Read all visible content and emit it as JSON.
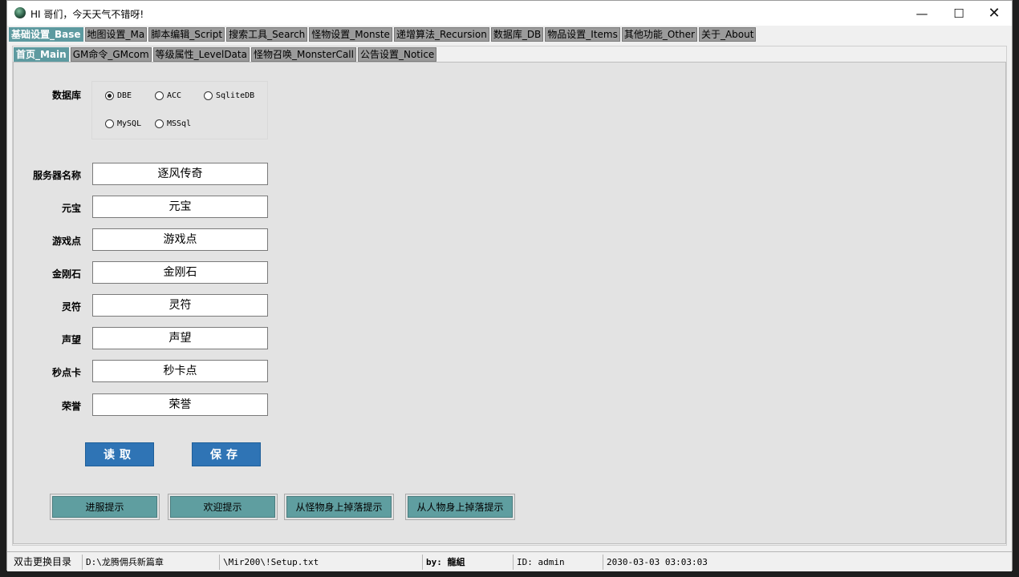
{
  "window": {
    "title": "HI 哥们，今天天气不错呀!"
  },
  "main_tabs": [
    {
      "label": "基础设置_Base",
      "active": true
    },
    {
      "label": "地图设置_Ma"
    },
    {
      "label": "脚本编辑_Script"
    },
    {
      "label": "搜索工具_Search"
    },
    {
      "label": "怪物设置_Monste"
    },
    {
      "label": "递增算法_Recursion"
    },
    {
      "label": "数据库_DB"
    },
    {
      "label": "物品设置_Items"
    },
    {
      "label": "其他功能_Other"
    },
    {
      "label": "关于_About"
    }
  ],
  "sub_tabs": [
    {
      "label": "首页_Main",
      "active": true
    },
    {
      "label": "GM命令_GMcom"
    },
    {
      "label": "等级属性_LevelData"
    },
    {
      "label": "怪物召唤_MonsterCall"
    },
    {
      "label": "公告设置_Notice"
    }
  ],
  "database": {
    "label": "数据库",
    "options": [
      {
        "label": "DBE",
        "selected": true
      },
      {
        "label": "ACC",
        "selected": false
      },
      {
        "label": "SqliteDB",
        "selected": false
      },
      {
        "label": "MySQL",
        "selected": false
      },
      {
        "label": "MSSql",
        "selected": false
      }
    ]
  },
  "fields": [
    {
      "label": "服务器名称",
      "value": "逐风传奇"
    },
    {
      "label": "元宝",
      "value": "元宝"
    },
    {
      "label": "游戏点",
      "value": "游戏点"
    },
    {
      "label": "金刚石",
      "value": "金刚石"
    },
    {
      "label": "灵符",
      "value": "灵符"
    },
    {
      "label": "声望",
      "value": "声望"
    },
    {
      "label": "秒点卡",
      "value": "秒卡点"
    },
    {
      "label": "荣誉",
      "value": "荣誉"
    }
  ],
  "buttons": {
    "read": "读取",
    "save": "保存"
  },
  "notice_buttons": [
    "进服提示",
    "欢迎提示",
    "从怪物身上掉落提示",
    "从人物身上掉落提示"
  ],
  "status": {
    "change_dir": "双击更换目录",
    "path": "D:\\龙腾佣兵新篇章",
    "setup": "\\Mir200\\!Setup.txt",
    "by": "by: 龍組",
    "id": "ID: admin",
    "datetime": "2030-03-03 03:03:03"
  },
  "colors": {
    "accent_tab": "#5d9aa0",
    "primary_button": "#2f74b5",
    "notice_button": "#5f9ea0"
  }
}
